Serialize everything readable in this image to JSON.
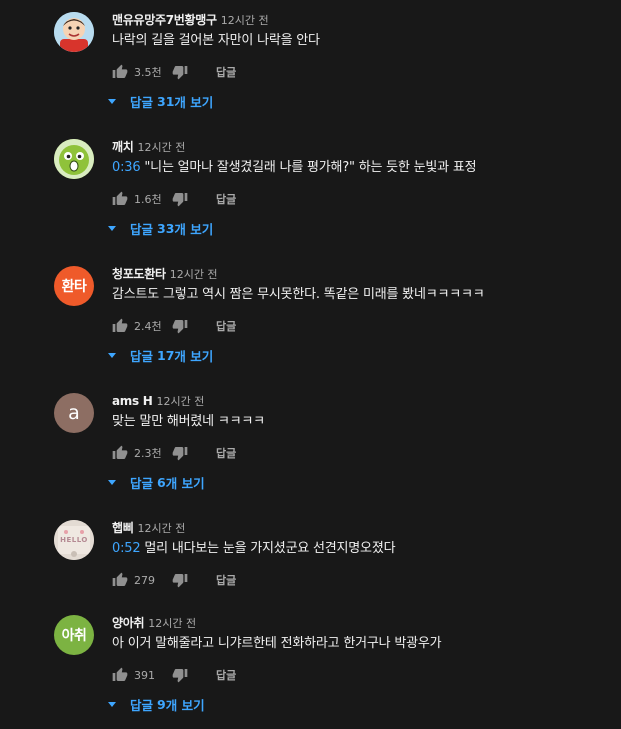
{
  "colors": {
    "background": "#181818",
    "text": "#f1f1f1",
    "secondary": "#aaaaaa",
    "link": "#3ea6ff"
  },
  "labels": {
    "reply": "답글",
    "replies_prefix": "답글",
    "replies_suffix": "개 보기"
  },
  "comments": [
    {
      "author": "맨유유망주7번황맹구",
      "time": "12시간 전",
      "timestamp": "",
      "text": "나락의 길을 걸어본 자만이 나락을 안다",
      "likes": "3.5천",
      "reply_count": "31",
      "avatar": {
        "type": "cartoon-boy",
        "text": "",
        "color": "#8fc8e8"
      }
    },
    {
      "author": "깨치",
      "time": "12시간 전",
      "timestamp": "0:36",
      "text": "\"니는 얼마나 잘생겼길래 나를 평가해?\" 하는 듯한 눈빛과 표정",
      "likes": "1.6천",
      "reply_count": "33",
      "avatar": {
        "type": "green-face",
        "text": "",
        "color": "#93c83e"
      }
    },
    {
      "author": "청포도환타",
      "time": "12시간 전",
      "timestamp": "",
      "text": "감스트도 그렇고 역시 짬은 무시못한다. 똑같은 미래를 봤네ㅋㅋㅋㅋㅋ",
      "likes": "2.4천",
      "reply_count": "17",
      "avatar": {
        "type": "text",
        "text": "환타",
        "color": "#ef5a2a"
      }
    },
    {
      "author": "ams H",
      "time": "12시간 전",
      "timestamp": "",
      "text": "맞는 말만 해버렸네 ㅋㅋㅋㅋ",
      "likes": "2.3천",
      "reply_count": "6",
      "avatar": {
        "type": "letter",
        "text": "a",
        "color": "#8d6e63"
      }
    },
    {
      "author": "햅삐",
      "time": "12시간 전",
      "timestamp": "0:52",
      "text": "멀리 내다보는 눈을 가지셨군요 선견지명오졌다",
      "likes": "279",
      "reply_count": "",
      "avatar": {
        "type": "photo",
        "text": "HELLO",
        "color": "#d7cfc8"
      }
    },
    {
      "author": "양아취",
      "time": "12시간 전",
      "timestamp": "",
      "text": "아 이거 말해줄라고 니갸르한테 전화하라고 한거구나 박광우가",
      "likes": "391",
      "reply_count": "9",
      "avatar": {
        "type": "text",
        "text": "아취",
        "color": "#7cb342"
      }
    }
  ]
}
